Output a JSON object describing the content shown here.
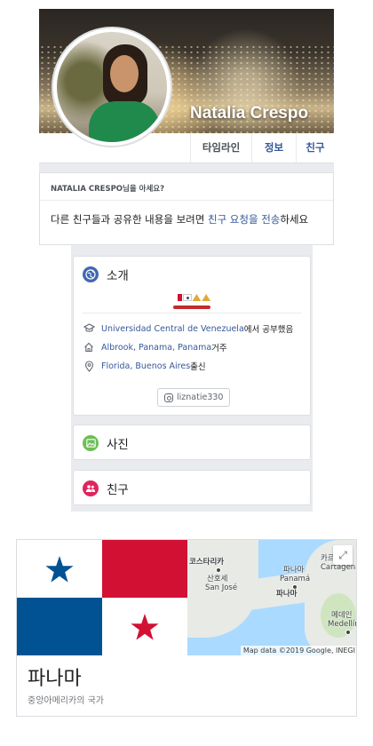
{
  "profile": {
    "name": "Natalia Crespo",
    "tabs": [
      "타임라인",
      "정보",
      "친구"
    ]
  },
  "know_prompt": {
    "heading": "NATALIA CRESPO님을 아세요?",
    "text_before": "다른 친구들과 공유한 내용을 보려면 ",
    "link": "친구 요청을 전송",
    "text_after": "하세요"
  },
  "intro": {
    "title": "소개",
    "education_link": "Universidad Central de Venezuela",
    "education_suffix": "에서 공부했음",
    "lives_link": "Albrook, Panama, Panama",
    "lives_suffix": " 거주",
    "from_link": "Florida, Buenos Aires",
    "from_suffix": " 출신",
    "instagram": "liznatie330",
    "icons": [
      "globe-icon",
      "graduation-cap-icon",
      "home-icon",
      "location-pin-icon",
      "instagram-icon"
    ]
  },
  "photos": {
    "title": "사진",
    "icon": "photo-icon"
  },
  "friends": {
    "title": "친구",
    "icon": "friends-icon"
  },
  "knowledge_panel": {
    "title": "파나마",
    "subtitle": "중앙아메리카의 국가",
    "map_labels": {
      "costa_rica": "코스타리카",
      "cartagena_ko": "카르타",
      "cartagena": "Cartagena",
      "san_jose_ko": "산호세",
      "san_jose": "San José",
      "panama_city_ko": "파나마",
      "panama_city": "Panamá",
      "panama_country": "파나마",
      "medellin_ko": "메데인",
      "medellin": "Medellín"
    },
    "map_credit": "Map data ©2019 Google, INEGI"
  },
  "colors": {
    "fb_link": "#365899",
    "intro_icon": "#4267b2",
    "photos_icon": "#6bbf56",
    "friends_icon": "#e0245e",
    "panama_blue": "#005293",
    "panama_red": "#d21034"
  }
}
